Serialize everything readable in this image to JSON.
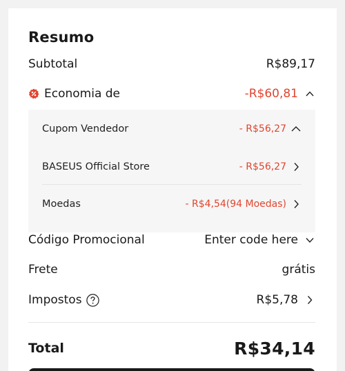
{
  "summary": {
    "title": "Resumo",
    "subtotal_label": "Subtotal",
    "subtotal_value": "R$89,17",
    "savings_label": "Economia de",
    "savings_value": "-R$60,81",
    "savings_items": [
      {
        "label": "Cupom Vendedor",
        "value": "- R$56,27"
      },
      {
        "label": "BASEUS Official Store",
        "value": "- R$56,27"
      },
      {
        "label": "Moedas",
        "value": "- R$4,54(94 Moedas)"
      }
    ],
    "promo_label": "Código Promocional",
    "promo_value": "Enter code here",
    "shipping_label": "Frete",
    "shipping_value": "grátis",
    "taxes_label": "Impostos",
    "taxes_value": "R$5,78",
    "total_label": "Total",
    "total_value": "R$34,14"
  },
  "colors": {
    "accent_red": "#e0452f",
    "text": "#191919",
    "button": "#191919"
  },
  "icons": [
    "discount-icon",
    "chevron-up-icon",
    "chevron-right-icon",
    "chevron-down-icon",
    "help-icon"
  ]
}
